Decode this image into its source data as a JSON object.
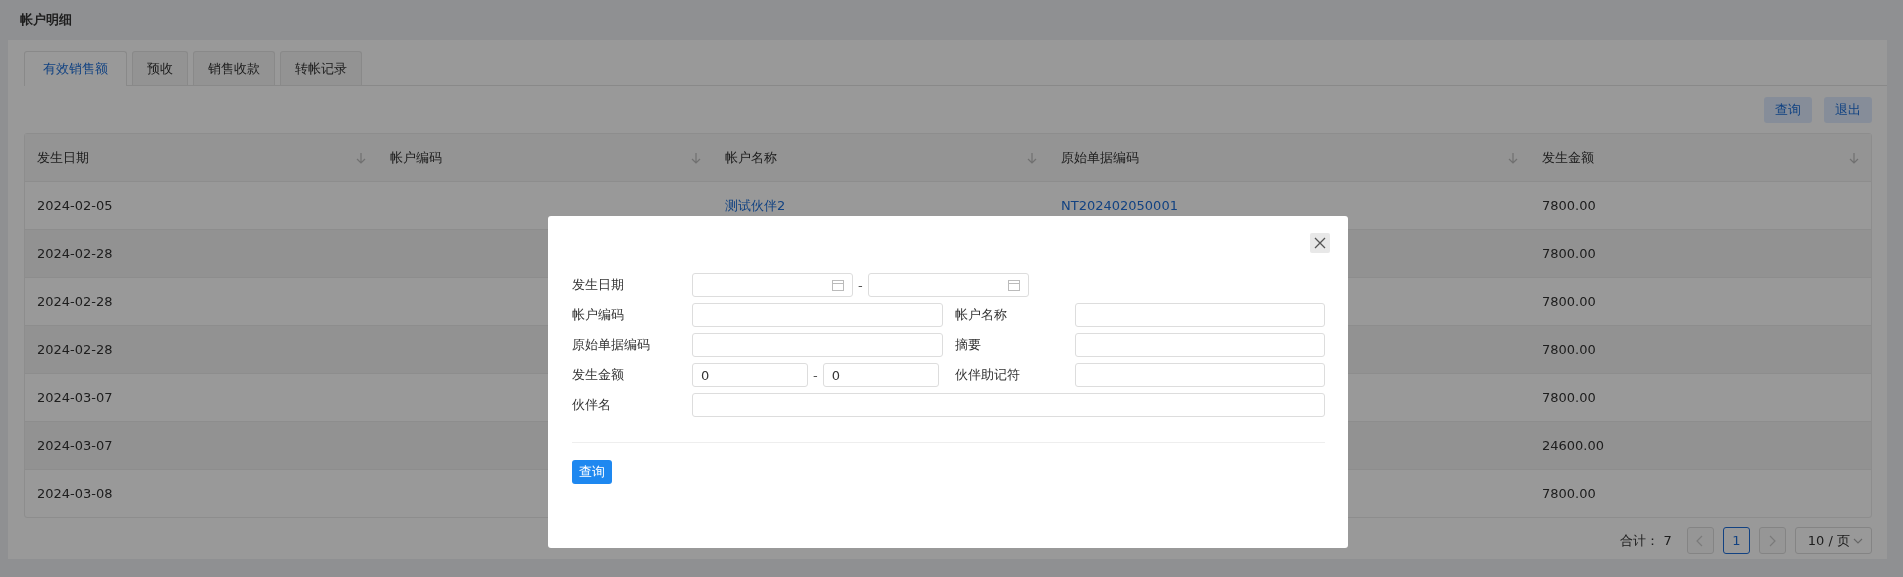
{
  "page_title": "帐户明细",
  "tabs": [
    {
      "label": "有效销售额",
      "selected": true
    },
    {
      "label": "预收",
      "selected": false
    },
    {
      "label": "销售收款",
      "selected": false
    },
    {
      "label": "转帐记录",
      "selected": false
    }
  ],
  "toolbar_buttons": [
    "查询",
    "退出"
  ],
  "table": {
    "columns": [
      "发生日期",
      "帐户编码",
      "帐户名称",
      "原始单据编码",
      "发生金额"
    ],
    "rows": [
      {
        "date": "2024-02-05",
        "account_name": "测试伙伴2",
        "source_no": "NT202402050001",
        "amount": "7800.00"
      },
      {
        "date": "2024-02-28",
        "amount": "7800.00"
      },
      {
        "date": "2024-02-28",
        "amount": "7800.00"
      },
      {
        "date": "2024-02-28",
        "amount": "7800.00"
      },
      {
        "date": "2024-03-07",
        "amount": "7800.00"
      },
      {
        "date": "2024-03-07",
        "amount": "24600.00"
      },
      {
        "date": "2024-03-08",
        "amount": "7800.00"
      }
    ]
  },
  "pagination": {
    "total_label": "合计：",
    "total": "7",
    "pages": [
      {
        "label": "1",
        "selected": true
      }
    ],
    "prev_disabled": true,
    "next_disabled": true,
    "page_size": "10 / 页"
  },
  "dialog": {
    "fields": [
      {
        "kind": "date_range",
        "label": "发生日期",
        "separator": "-"
      },
      {
        "kind": "text",
        "label": "帐户编码"
      },
      {
        "kind": "text",
        "label": "帐户名称"
      },
      {
        "kind": "text",
        "label": "原始单据编码"
      },
      {
        "kind": "text",
        "label": "摘要"
      },
      {
        "kind": "number_range",
        "label": "发生金额",
        "from": "0",
        "to": "0",
        "separator": "-"
      },
      {
        "kind": "text",
        "label": "伙伴助记符"
      },
      {
        "kind": "wide_text",
        "label": "伙伴名"
      }
    ],
    "submit": "查询"
  }
}
